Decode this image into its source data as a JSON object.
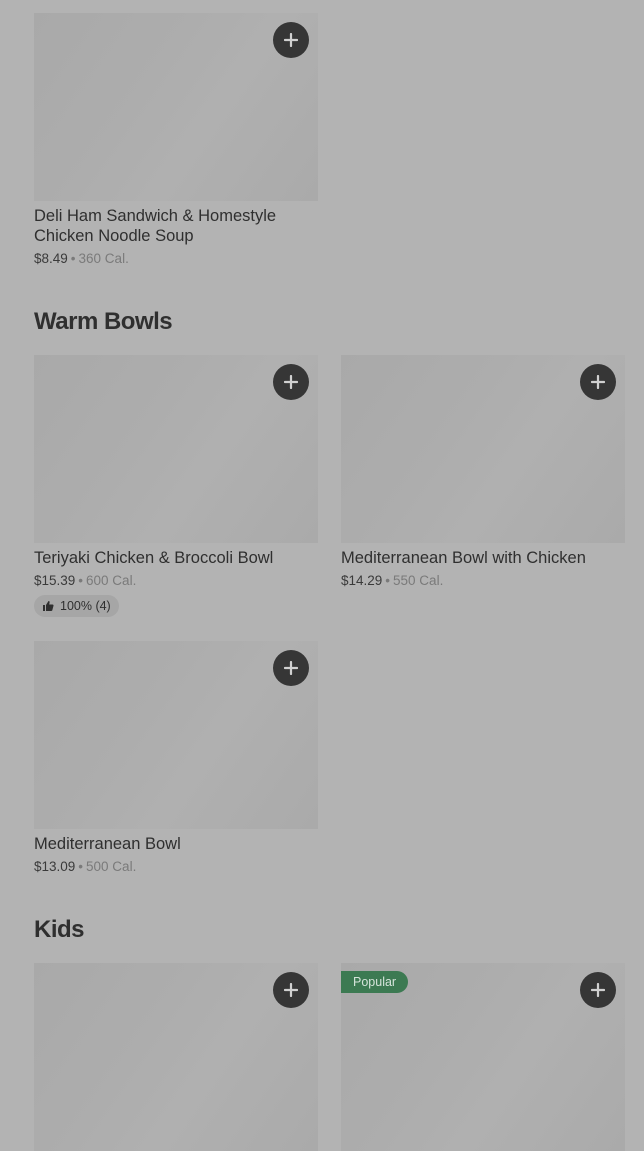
{
  "sections": [
    {
      "title": ""
    },
    {
      "title": "Warm Bowls"
    },
    {
      "title": "Kids"
    }
  ],
  "items": [
    {
      "name": "Deli Ham Sandwich & Homestyle Chicken Noodle Soup",
      "price": "$8.49",
      "sep": "•",
      "cal": "360 Cal."
    },
    {
      "name": "Teriyaki Chicken & Broccoli Bowl",
      "price": "$15.39",
      "sep": "•",
      "cal": "600 Cal.",
      "rating": "100% (4)"
    },
    {
      "name": "Mediterranean Bowl with Chicken",
      "price": "$14.29",
      "sep": "•",
      "cal": "550 Cal."
    },
    {
      "name": "Mediterranean Bowl",
      "price": "$13.09",
      "sep": "•",
      "cal": "500 Cal."
    },
    {
      "name": "",
      "price": "",
      "sep": "",
      "cal": ""
    },
    {
      "name": "",
      "price": "",
      "sep": "",
      "cal": "",
      "badge": "Popular"
    }
  ],
  "icons": {
    "add": "plus-icon",
    "thumb": "thumbs-up-icon"
  }
}
